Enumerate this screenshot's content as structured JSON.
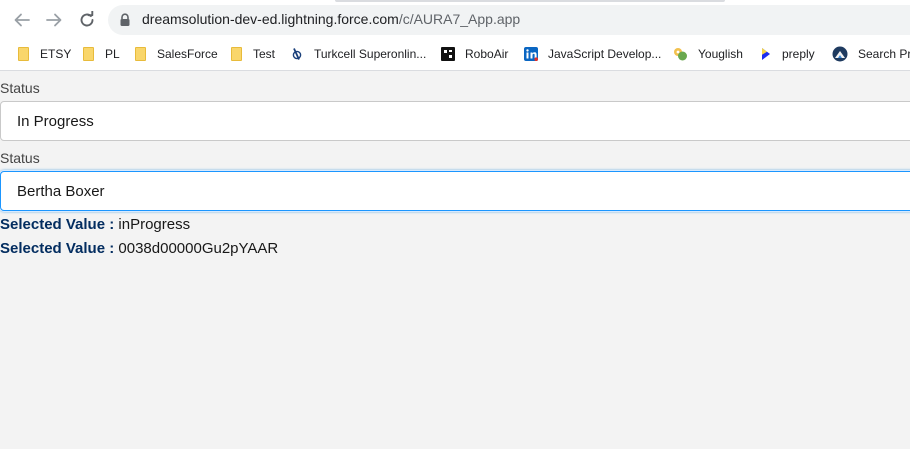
{
  "browser": {
    "url_host": "dreamsolution-dev-ed.lightning.force.com",
    "url_path": "/c/AURA7_App.app",
    "bookmarks": [
      {
        "label": "ETSY",
        "icon": "folder-icon"
      },
      {
        "label": "PL",
        "icon": "folder-icon"
      },
      {
        "label": "SalesForce",
        "icon": "folder-icon"
      },
      {
        "label": "Test",
        "icon": "folder-icon"
      },
      {
        "label": "Turkcell Superonlin...",
        "icon": "turkcell-icon"
      },
      {
        "label": "RoboAir",
        "icon": "roboair-icon"
      },
      {
        "label": "JavaScript Develop...",
        "icon": "linkedin-icon"
      },
      {
        "label": "Youglish",
        "icon": "youglish-icon"
      },
      {
        "label": "preply",
        "icon": "preply-icon"
      },
      {
        "label": "Search Pro",
        "icon": "search-pro-icon"
      }
    ]
  },
  "form": {
    "status_label_1": "Status",
    "status_value_1": "In Progress",
    "status_label_2": "Status",
    "status_value_2": "Bertha Boxer",
    "selected_label": "Selected Value :",
    "selected_value_1": "inProgress",
    "selected_value_2": "0038d00000Gu2pYAAR"
  },
  "colors": {
    "focus_border": "#1b96ff",
    "label_bold": "#032d60",
    "page_background": "#f3f3f3"
  }
}
